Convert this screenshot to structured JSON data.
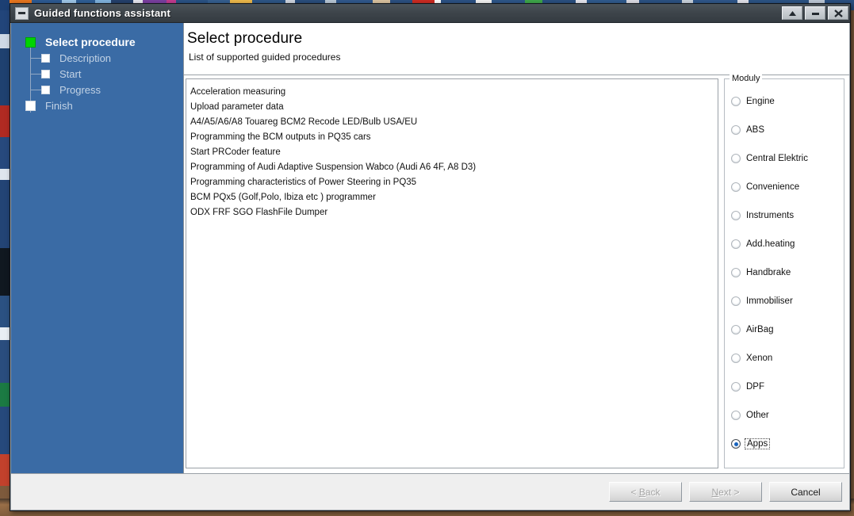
{
  "window": {
    "title": "Guided functions assistant",
    "system_icon": "minimize-box-icon",
    "controls": {
      "restore": "restore-up-icon",
      "minimize": "minimize-icon",
      "close": "close-icon"
    }
  },
  "sidebar": {
    "steps": [
      {
        "label": "Select procedure",
        "state": "active"
      },
      {
        "label": "Description",
        "state": "pending"
      },
      {
        "label": "Start",
        "state": "pending"
      },
      {
        "label": "Progress",
        "state": "pending"
      },
      {
        "label": "Finish",
        "state": "pending"
      }
    ]
  },
  "header": {
    "title": "Select procedure",
    "subtitle": "List of supported guided procedures"
  },
  "procedures": [
    "Acceleration measuring",
    "Upload parameter data",
    "A4/A5/A6/A8 Touareg BCM2 Recode LED/Bulb USA/EU",
    "Programming the BCM outputs in PQ35 cars",
    "Start PRCoder feature",
    "Programming of Audi Adaptive Suspension Wabco (Audi A6 4F, A8 D3)",
    "Programming characteristics of Power Steering in PQ35",
    "BCM PQx5 (Golf,Polo, Ibiza etc ) programmer",
    "ODX FRF SGO FlashFile Dumper"
  ],
  "modules": {
    "legend": "Moduly",
    "selected": "Apps",
    "options": [
      "Engine",
      "ABS",
      "Central Elektric",
      "Convenience",
      "Instruments",
      "Add.heating",
      "Handbrake",
      "Immobiliser",
      "AirBag",
      "Xenon",
      "DPF",
      "Other",
      "Apps"
    ]
  },
  "footer": {
    "back": "< Back",
    "next": "Next >",
    "cancel": "Cancel"
  },
  "colors": {
    "sidebar": "#3a6ba5",
    "active_step": "#00d400",
    "titlebar": "#3e454b",
    "radio_selected": "#1763bd"
  }
}
